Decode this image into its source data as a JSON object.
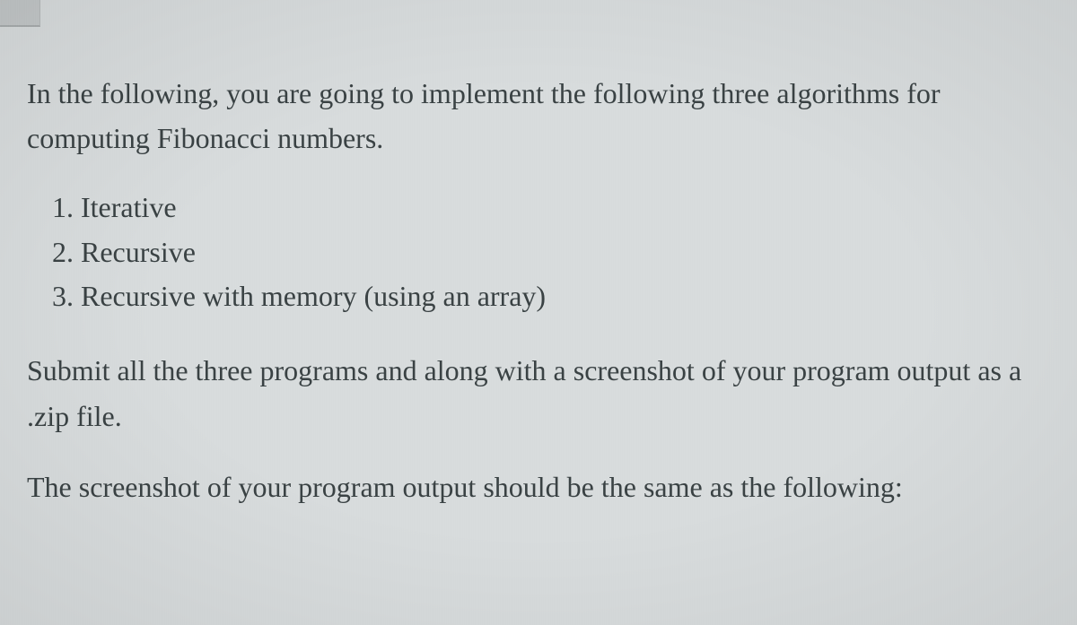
{
  "intro": "In the following, you are going to implement the following three algorithms for computing Fibonacci numbers.",
  "list": {
    "items": [
      {
        "num": "1.",
        "text": "Iterative"
      },
      {
        "num": "2.",
        "text": "Recursive"
      },
      {
        "num": "3.",
        "text": "Recursive with memory (using an array)"
      }
    ]
  },
  "submit": "Submit all the three programs and along with a screenshot of your program output as a .zip file.",
  "output_note": "The screenshot of your program output should be the same as the following:"
}
